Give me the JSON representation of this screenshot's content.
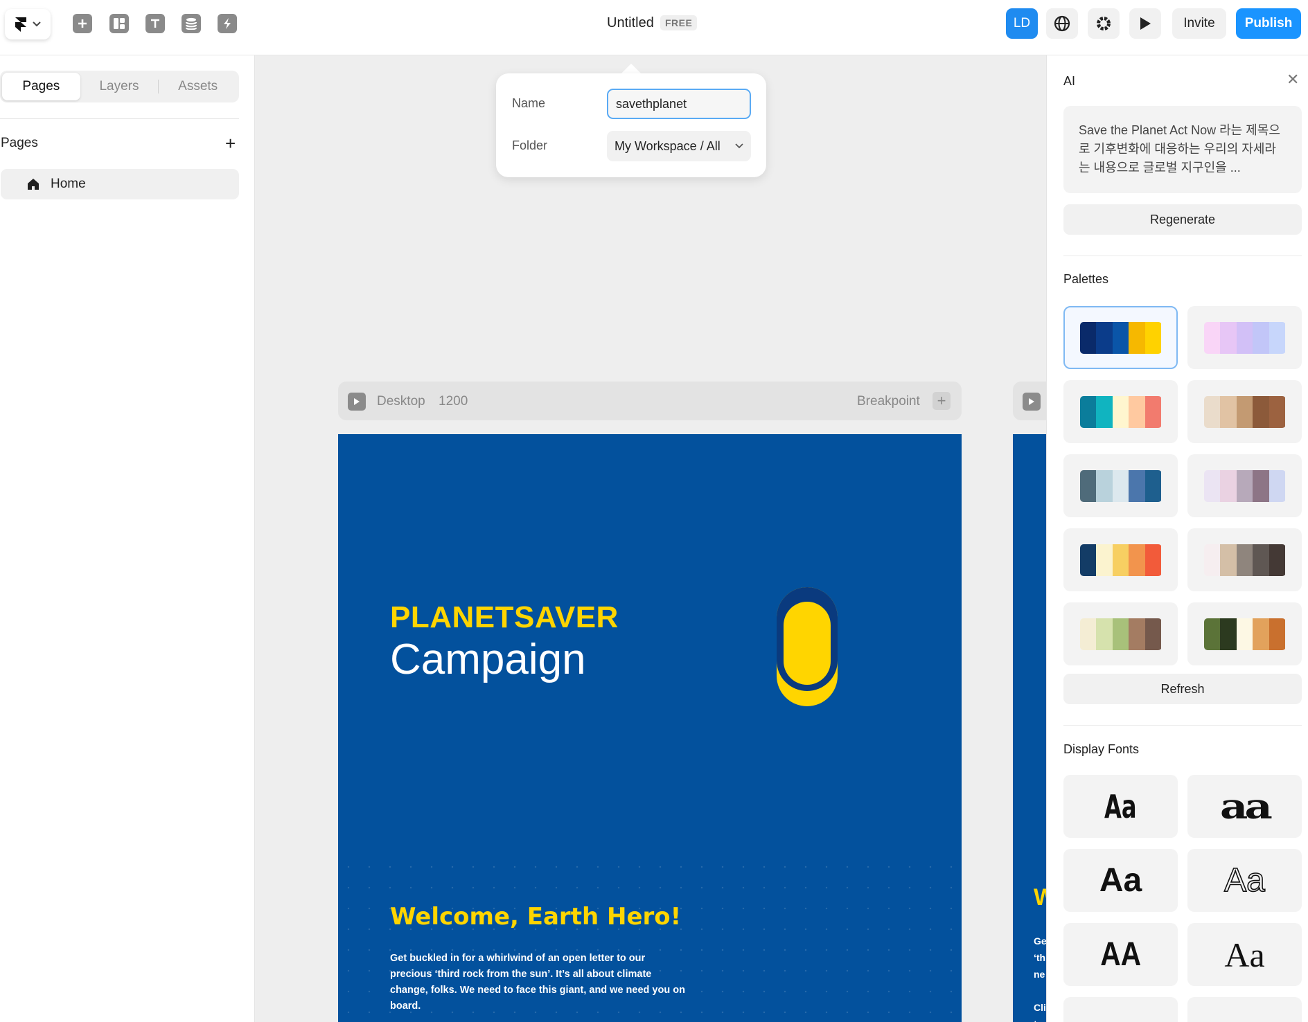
{
  "topbar": {
    "title": "Untitled",
    "plan_badge": "FREE",
    "avatar_initials": "LD",
    "invite_label": "Invite",
    "publish_label": "Publish",
    "tools": [
      "insert-icon",
      "layout-icon",
      "text-icon",
      "cms-icon",
      "interactions-icon"
    ],
    "right_icons": [
      "globe-icon",
      "gear-icon",
      "play-icon"
    ]
  },
  "left_panel": {
    "tabs": [
      "Pages",
      "Layers",
      "Assets"
    ],
    "active_tab": "Pages",
    "section_title": "Pages",
    "pages": [
      {
        "label": "Home",
        "icon": "home-icon"
      }
    ]
  },
  "popover": {
    "name_label": "Name",
    "name_value": "savethplanet",
    "folder_label": "Folder",
    "folder_value": "My Workspace / All"
  },
  "canvas": {
    "frame_name": "Desktop",
    "frame_width": "1200",
    "breakpoint_label": "Breakpoint",
    "site": {
      "brand": "PLANETSAVER",
      "headline": "Campaign",
      "welcome": "Welcome, Earth Hero!",
      "intro": "Get buckled in for a whirlwind of an open letter to our precious ‘third rock from the sun’. It’s all about climate change, folks. We need to face this giant, and we need you on board.",
      "background": "#03519d",
      "accent": "#ffd500"
    },
    "second_frame": {
      "welcome_fragment": "W",
      "text_lines": [
        "Ge",
        "‘th",
        "ne",
        "",
        "Cli",
        "te"
      ]
    }
  },
  "right_panel": {
    "title": "AI",
    "prompt": "Save the Planet Act Now 라는 제목으로 기후변화에 대응하는 우리의 자세라는 내용으로 글로벌 지구인을 ...",
    "regenerate_label": "Regenerate",
    "palettes_title": "Palettes",
    "palettes": [
      [
        "#0a2a6a",
        "#0b3c8a",
        "#0a55a8",
        "#f6b800",
        "#ffd200"
      ],
      [
        "#f9d5f7",
        "#e7c6f6",
        "#d2c0f7",
        "#c2c6f8",
        "#c7d6fb"
      ],
      [
        "#0b7d9b",
        "#10b4c0",
        "#fff6cf",
        "#ffc9a0",
        "#f27b6e"
      ],
      [
        "#eadccb",
        "#e1c3a4",
        "#c39a72",
        "#8c5a3a",
        "#9c6240"
      ],
      [
        "#4f6b7a",
        "#b9d2dc",
        "#dce8ee",
        "#4b76ac",
        "#1e5f8e"
      ],
      [
        "#ebe4f3",
        "#ead2e2",
        "#b7a9ba",
        "#8d7586",
        "#cfd7f2"
      ],
      [
        "#133c66",
        "#fbf3cf",
        "#f7cf62",
        "#f2944d",
        "#f25b3a"
      ],
      [
        "#f6eef0",
        "#d4bfa7",
        "#8f857d",
        "#5f5753",
        "#443935"
      ],
      [
        "#f4edd4",
        "#d6e2ad",
        "#a8c17a",
        "#a47c62",
        "#75594c"
      ],
      [
        "#5b7338",
        "#2c3a1f",
        "#fdf8e4",
        "#e2a25c",
        "#c9702e"
      ]
    ],
    "refresh_label": "Refresh",
    "fonts_title": "Display Fonts",
    "fonts": [
      "Aa",
      "aa",
      "Aa",
      "Aa",
      "AA",
      "Aa"
    ]
  }
}
